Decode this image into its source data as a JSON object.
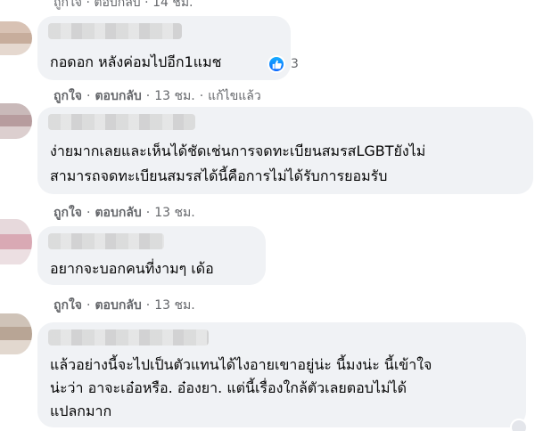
{
  "top_meta": {
    "like": "ถูกใจ",
    "reply": "ตอบกลับ",
    "time": "14 ชม."
  },
  "comments": [
    {
      "lines": [
        "กอดอก หลังค่อมไปอีก1แมช"
      ],
      "reaction_count": "3",
      "actions": {
        "like": "ถูกใจ",
        "reply": "ตอบกลับ",
        "time": "13 ชม.",
        "edited": "แก้ไขแล้ว"
      }
    },
    {
      "lines": [
        "ง่ายมากเลยและเห็นได้ชัดเช่นการจดทะเบียนสมรสLGBTยังไม่",
        "สามารถจดทะเบียนสมรสได้นี้คือการไม่ได้รับการยอมรับ"
      ],
      "actions": {
        "like": "ถูกใจ",
        "reply": "ตอบกลับ",
        "time": "13 ชม."
      }
    },
    {
      "lines": [
        "อยากจะบอกคนที่งามๆ เด้อ"
      ],
      "actions": {
        "like": "ถูกใจ",
        "reply": "ตอบกลับ",
        "time": "13 ชม."
      }
    },
    {
      "lines": [
        "แล้วอย่างนี้จะไปเป็นตัวแทนได้ไงอายเขาอยู่น่ะ นี้มงน่ะ นี้เข้าใจ",
        "น่ะว่า อาจะเอ๋อหรือ. อ๋องยา. แต่นี้เรื่องใกล้ตัวเลยตอบไม่ได้",
        "แปลกมาก"
      ]
    }
  ],
  "colors": {
    "bubble": "#f0f2f5",
    "meta": "#65676b",
    "text": "#050505",
    "like_blue": "#0866ff"
  }
}
